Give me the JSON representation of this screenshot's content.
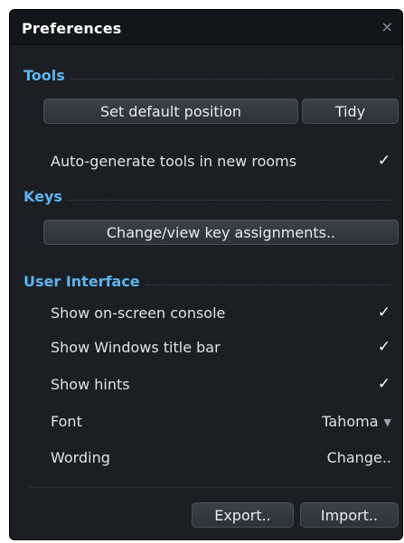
{
  "window": {
    "title": "Preferences",
    "close_glyph": "×"
  },
  "tools": {
    "heading": "Tools",
    "set_default_position": "Set default position",
    "tidy": "Tidy",
    "auto_generate_label": "Auto-generate tools in new rooms",
    "auto_generate_checked": true
  },
  "keys": {
    "heading": "Keys",
    "change_view_button": "Change/view key assignments.."
  },
  "user_interface": {
    "heading": "User Interface",
    "show_console_label": "Show on-screen console",
    "show_console_checked": true,
    "show_title_bar_label": "Show Windows title bar",
    "show_title_bar_checked": true,
    "show_hints_label": "Show hints",
    "show_hints_checked": true,
    "font_label": "Font",
    "font_value": "Tahoma",
    "wording_label": "Wording",
    "wording_action": "Change.."
  },
  "footer": {
    "export_button": "Export..",
    "import_button": "Import.."
  },
  "glyphs": {
    "check": "✓",
    "dropdown": "▼"
  },
  "colors": {
    "panel_bg": "#1b1f24",
    "section_heading": "#5fb4ee",
    "button_bg": "#343a40"
  }
}
